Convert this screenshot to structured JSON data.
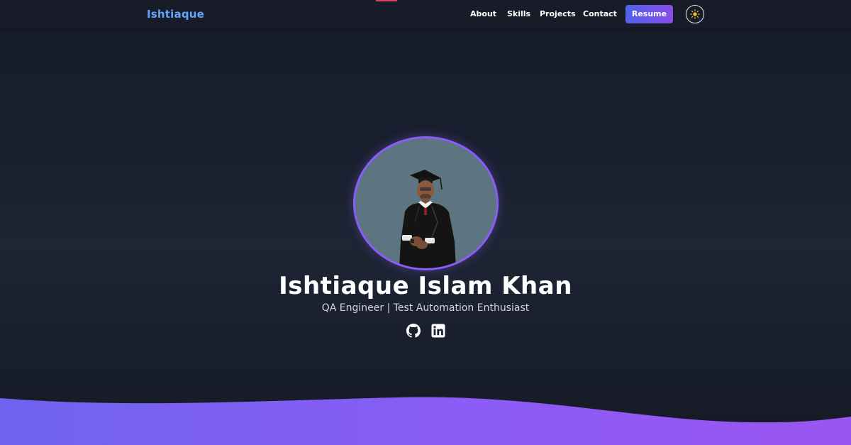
{
  "brand": "Ishtiaque",
  "nav": {
    "about": "About",
    "skills": "Skills",
    "projects": "Projects",
    "contact": "Contact",
    "resume": "Resume"
  },
  "hero": {
    "name": "Ishtiaque Islam Khan",
    "subtitle": "QA Engineer | Test Automation Enthusiast"
  },
  "icons": {
    "theme_toggle": "sun-icon",
    "social": [
      "github-icon",
      "linkedin-icon"
    ]
  },
  "colors": {
    "brand": "#60a5fa",
    "accent_start": "#4f63ec",
    "accent_end": "#8a4de8",
    "avatar_ring": "#8b5cf6",
    "sun": "#fbbf24",
    "background": "#1a2030"
  }
}
